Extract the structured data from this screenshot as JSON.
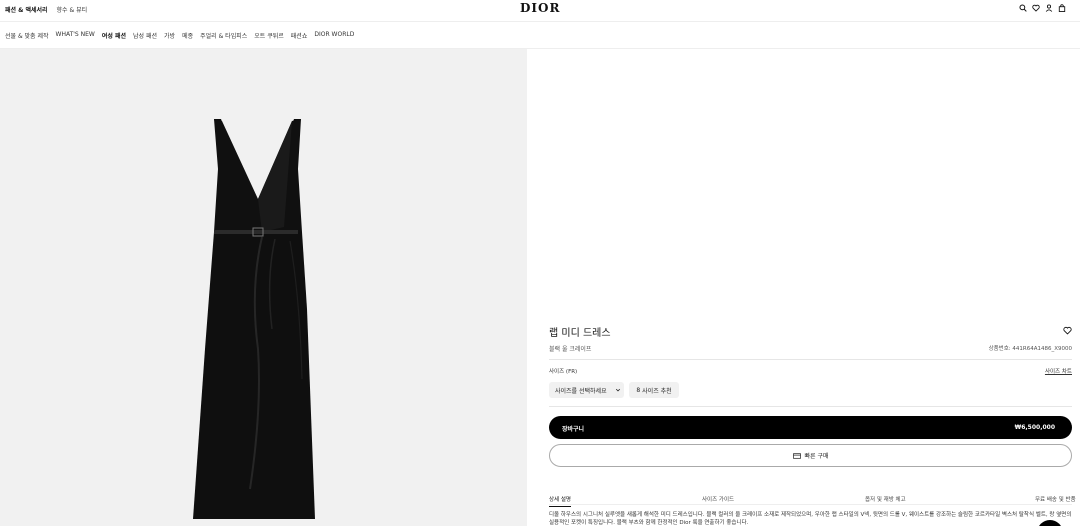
{
  "topbar": {
    "links": [
      "패션 & 액세서리",
      "향수 & 뷰티"
    ],
    "logo": "DIOR",
    "icons": [
      "search-icon",
      "heart-icon",
      "user-icon",
      "bag-icon"
    ]
  },
  "catnav": {
    "items": [
      "선물 & 맞춤 제작",
      "WHAT'S NEW",
      "여성 패션",
      "남성 패션",
      "가방",
      "메종",
      "주얼리 & 타임피스",
      "오트 쿠튀르",
      "패션쇼",
      "DIOR WORLD"
    ]
  },
  "product": {
    "title": "랩 미디 드레스",
    "subtitle": "블랙 울 크레이프",
    "reference": "상품번호: 441R64A1486_X9000",
    "size_label": "사이즈 (FR)",
    "size_chart": "사이즈 차트",
    "size_select": "사이즈를 선택하세요",
    "size_recommend_icon": "8",
    "size_recommend": "사이즈 추천",
    "cart_label": "장바구니",
    "price": "₩6,500,000",
    "quick_buy": "빠른 구매",
    "tabs": [
      "상세 설명",
      "사이즈 가이드",
      "옵저 및 재방 체고",
      "무료 배송 및 반품"
    ],
    "description": "디올 하우스의 시그니처 실루엣을 새롭게 해석한 미디 드레스입니다. 블랙 컬러의 울 크레이프 소재로 제작되었으며, 우아한 랩 스타일의 V넥, 뒷면의 드롤 V, 웨이스트를 강조하는 슬림한 코르카타일 벽스처 탈착식 벨트, 랑 옆면의 실용적인 포켓이 특징입니다. 블랙 부츠와 함께 한정적인 Dior 룩을 연출하기 좋습니다."
  }
}
